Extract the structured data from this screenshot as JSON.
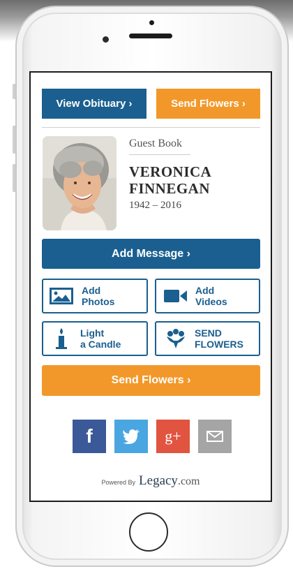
{
  "buttons": {
    "view_obituary": "View Obituary ›",
    "send_flowers_top": "Send Flowers ›",
    "add_message": "Add Message ›",
    "add_photos_line1": "Add",
    "add_photos_line2": "Photos",
    "add_videos_line1": "Add",
    "add_videos_line2": "Videos",
    "light_candle_line1": "Light",
    "light_candle_line2": "a Candle",
    "send_flowers_icon_line1": "SEND",
    "send_flowers_icon_line2": "FLOWERS",
    "send_flowers_bottom": "Send Flowers ›"
  },
  "guestbook": {
    "label": "Guest Book",
    "name_line1": "VERONICA",
    "name_line2": "FINNEGAN",
    "years": "1942 – 2016"
  },
  "social": {
    "facebook": "f",
    "googleplus": "g+"
  },
  "footer": {
    "powered_by": "Powered By",
    "brand": "Legacy",
    "brand_suffix": ".com"
  },
  "colors": {
    "primary_blue": "#1a5f8f",
    "accent_orange": "#f2982a",
    "facebook": "#3b5998",
    "twitter": "#4aa6e0",
    "googleplus": "#e15440",
    "email": "#a5a5a5"
  }
}
